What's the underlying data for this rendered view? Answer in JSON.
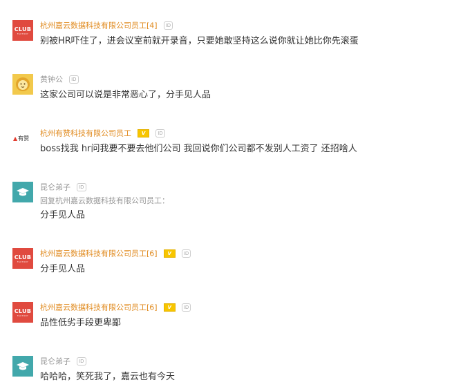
{
  "comments": [
    {
      "name": "杭州嘉云数据科技有限公司员工[4]",
      "avatar_text": "CLUB",
      "avatar_sub": "FACTORY",
      "badge_id": "ID",
      "text": "别被HR吓住了，进会议室前就开录音，只要她敢坚持这么说你就让她比你先滚蛋"
    },
    {
      "name": "黄钟公",
      "badge_id": "ID",
      "text": "这家公司可以说是非常恶心了，分手见人品"
    },
    {
      "name": "杭州有赞科技有限公司员工",
      "avatar_text": "有赞",
      "badge_v": "V",
      "badge_id": "ID",
      "text": "boss找我 hr问我要不要去他们公司 我回说你们公司都不发别人工资了 还招啥人"
    },
    {
      "name": "昆仑弟子",
      "badge_id": "ID",
      "reply_to": "回复杭州嘉云数据科技有限公司员工：",
      "text": "分手见人品"
    },
    {
      "name": "杭州嘉云数据科技有限公司员工[6]",
      "avatar_text": "CLUB",
      "avatar_sub": "FACTORY",
      "badge_v": "V",
      "badge_id": "ID",
      "text": "分手见人品"
    },
    {
      "name": "杭州嘉云数据科技有限公司员工[6]",
      "avatar_text": "CLUB",
      "avatar_sub": "FACTORY",
      "badge_v": "V",
      "badge_id": "ID",
      "text": "品性低劣手段更卑鄙"
    },
    {
      "name": "昆仑弟子",
      "badge_id": "ID",
      "text": "哈哈哈，笑死我了，嘉云也有今天"
    }
  ],
  "colors": {
    "company_name": "#e08a1e",
    "plain_name": "#999999",
    "club_avatar": "#e04a3f",
    "teal_avatar": "#42a8ab",
    "lion_avatar": "#f2c94c",
    "verified_badge": "#f7c500"
  }
}
